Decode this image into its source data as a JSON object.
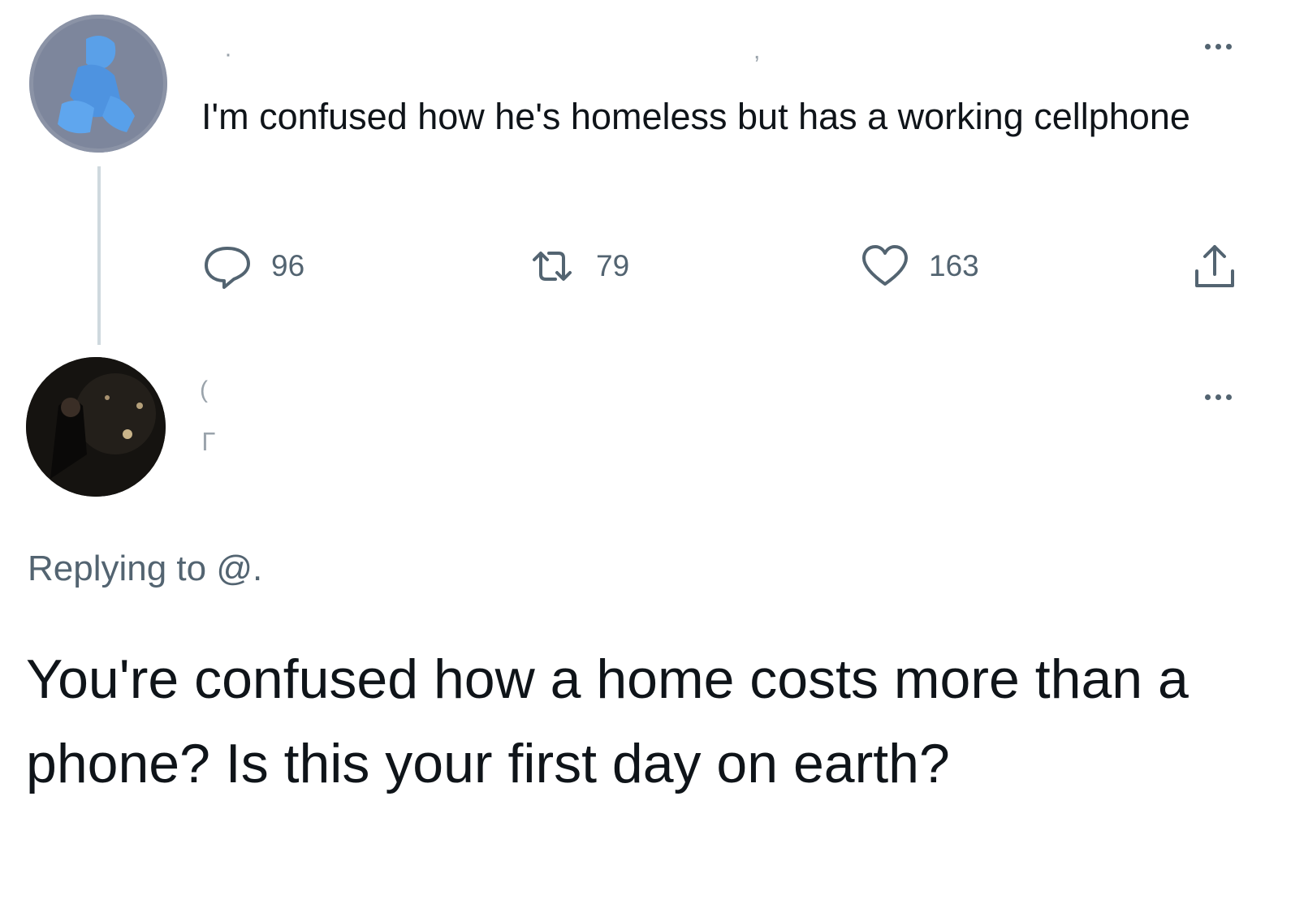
{
  "tweet_1": {
    "text": "I'm confused how he's homeless but has a working cellphone",
    "more_icon": "more-horizontal-icon",
    "stats": {
      "replies": "96",
      "retweets": "79",
      "likes": "163"
    },
    "icons": {
      "reply": "reply-bubble-icon",
      "retweet": "retweet-icon",
      "like": "heart-icon",
      "share": "share-icon"
    }
  },
  "tweet_2": {
    "replying_to": "Replying to @.",
    "text": "You're confused how a home costs more than a phone? Is this your first day on earth?",
    "more_icon": "more-horizontal-icon"
  },
  "colors": {
    "text_primary": "#0f1419",
    "text_secondary": "#536471",
    "thread_line": "#cfd9de",
    "background": "#ffffff"
  }
}
